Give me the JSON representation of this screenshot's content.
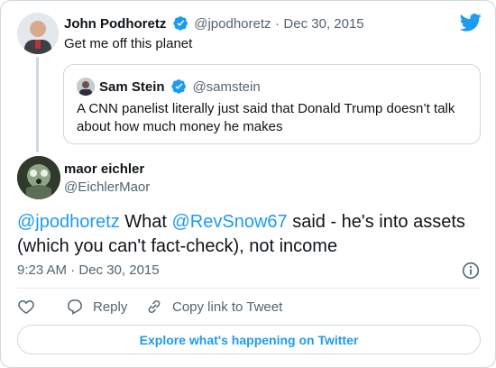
{
  "brand": {
    "accent": "#1d9bf0",
    "text": "#0f1419",
    "muted": "#536471",
    "border": "#cfd9de"
  },
  "parent_tweet": {
    "author_name": "John Podhoretz",
    "author_handle": "@jpodhoretz",
    "date_sep": "·",
    "date": "Dec 30, 2015",
    "text": "Get me off this planet",
    "verified": true
  },
  "quoted_tweet": {
    "author_name": "Sam Stein",
    "author_handle": "@samstein",
    "text": "A CNN panelist literally just said that Donald Trump doesn’t talk about how much money he makes",
    "verified": true
  },
  "main_tweet": {
    "author_name": "maor eichler",
    "author_handle": "@EichlerMaor",
    "mention_1": "@jpodhoretz",
    "text_1": " What ",
    "mention_2": "@RevSnow67",
    "text_2": " said - he's into assets (which you can't fact-check), not income",
    "timestamp": "9:23 AM · Dec 30, 2015"
  },
  "actions": {
    "reply_label": "Reply",
    "copy_label": "Copy link to Tweet",
    "icons": [
      "heart-icon",
      "reply-icon",
      "link-icon",
      "info-icon",
      "twitter-bird-icon",
      "verified-badge-icon"
    ]
  },
  "footer": {
    "explore_label": "Explore what's happening on Twitter"
  }
}
